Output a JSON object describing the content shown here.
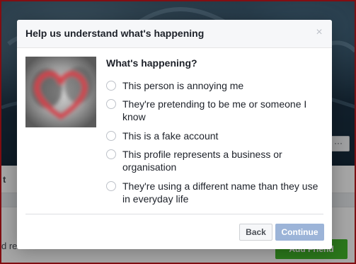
{
  "background": {
    "cover_more_label": "···",
    "bar_partial_label": "t",
    "partial_text": "d re",
    "add_friend_label": "Add Friend"
  },
  "dialog": {
    "title": "Help us understand what's happening",
    "close_label": "×",
    "question": "What's happening?",
    "options": [
      {
        "label": "This person is annoying me"
      },
      {
        "label": "They're pretending to be me or someone I know"
      },
      {
        "label": "This is a fake account"
      },
      {
        "label": "This profile represents a business or organisation"
      },
      {
        "label": "They're using a different name than they use in everyday life"
      }
    ],
    "back_label": "Back",
    "continue_label": "Continue"
  },
  "colors": {
    "primary_disabled": "#9cb4d8",
    "add_friend_green": "#42b72a",
    "frame_red": "#c8161d"
  }
}
